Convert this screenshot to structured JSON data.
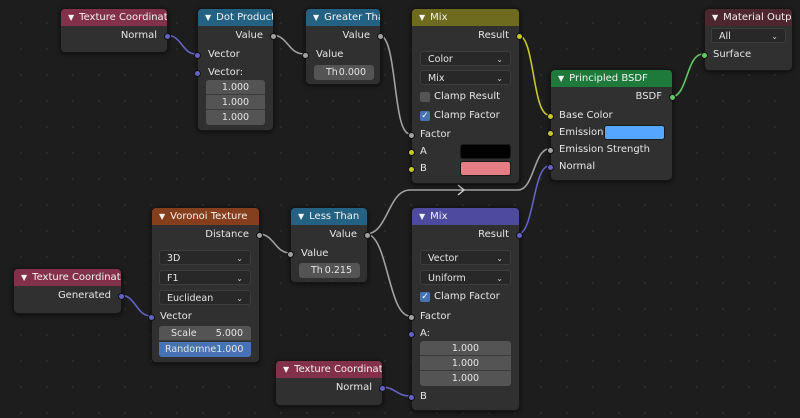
{
  "nodes": {
    "tc1": {
      "title": "Texture Coordinate",
      "output": "Normal"
    },
    "dot": {
      "title": "Dot Product",
      "output": "Value",
      "in1": "Vector",
      "in2": "Vector:",
      "values": [
        "1.000",
        "1.000",
        "1.000"
      ]
    },
    "gt": {
      "title": "Greater Than",
      "output": "Value",
      "input": "Value",
      "th_label": "Th",
      "th_value": "0.000"
    },
    "mix1": {
      "title": "Mix",
      "output": "Result",
      "dropdown1": "Color",
      "dropdown2": "Mix",
      "clamp_result": "Clamp Result",
      "clamp_factor": "Clamp Factor",
      "factor": "Factor",
      "a": "A",
      "b": "B",
      "a_color": "#000000",
      "b_color": "#e57d85"
    },
    "bsdf": {
      "title": "Principled BSDF",
      "output": "BSDF",
      "base_color": "Base Color",
      "emission": "Emission",
      "emission_strength": "Emission Strength",
      "normal": "Normal",
      "emission_color": "#55a6ff"
    },
    "matout": {
      "title": "Material Output",
      "dropdown": "All",
      "surface": "Surface"
    },
    "voronoi": {
      "title": "Voronoi Texture",
      "output": "Distance",
      "dropdown1": "3D",
      "dropdown2": "F1",
      "dropdown3": "Euclidean",
      "vector": "Vector",
      "scale_label": "Scale",
      "scale_value": "5.000",
      "rand_label": "Randomne",
      "rand_value": "1.000"
    },
    "lt": {
      "title": "Less Than",
      "output": "Value",
      "input": "Value",
      "th_label": "Th",
      "th_value": "0.215"
    },
    "tc2": {
      "title": "Texture Coordinate",
      "output": "Generated"
    },
    "mix2": {
      "title": "Mix",
      "output": "Result",
      "dropdown1": "Vector",
      "dropdown2": "Uniform",
      "clamp_factor": "Clamp Factor",
      "factor": "Factor",
      "a": "A:",
      "values": [
        "1.000",
        "1.000",
        "1.000"
      ],
      "b": "B"
    },
    "tc3": {
      "title": "Texture Coordinate",
      "output": "Normal"
    }
  },
  "colors": {
    "input_header": "#83314a",
    "converter_header": "#246283",
    "color_header": "#6e6a1e",
    "shader_header": "#1e7a3a",
    "output_header": "#4e2630",
    "texture_header": "#863f1c"
  }
}
